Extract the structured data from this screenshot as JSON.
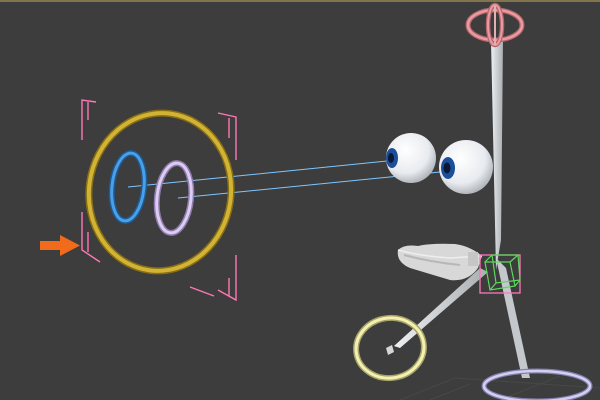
{
  "viewport": {
    "background": "#3d3d3d",
    "grid_color": "#494949",
    "grid": true,
    "view": "perspective"
  },
  "scene": {
    "eye_target_frame": {
      "color": "#ff77b6",
      "selected": true
    },
    "eye_control_ring": {
      "color": "#c9a82c"
    },
    "left_eye_target": {
      "color": "#3d8fd8"
    },
    "right_eye_target": {
      "color": "#c9b3e6"
    },
    "aim_lines": {
      "color": "#7fc6ff"
    },
    "eyeballs": {
      "color": "#f4f6f8",
      "iris_color": "#1d4e9a"
    },
    "head_ring": {
      "color": "#e78f96"
    },
    "spine_bone": {
      "color": "#d6dadd"
    },
    "jaw": {
      "color": "#d3d3d3"
    },
    "jaw_control": {
      "color": "#5bd95b",
      "frame_color": "#ff77b6"
    },
    "hand_ring": {
      "color": "#f3f0b0"
    },
    "base_ring": {
      "color": "#c6c2ea"
    },
    "arrow_indicator": {
      "color": "#f26a1b",
      "direction": "right"
    }
  }
}
